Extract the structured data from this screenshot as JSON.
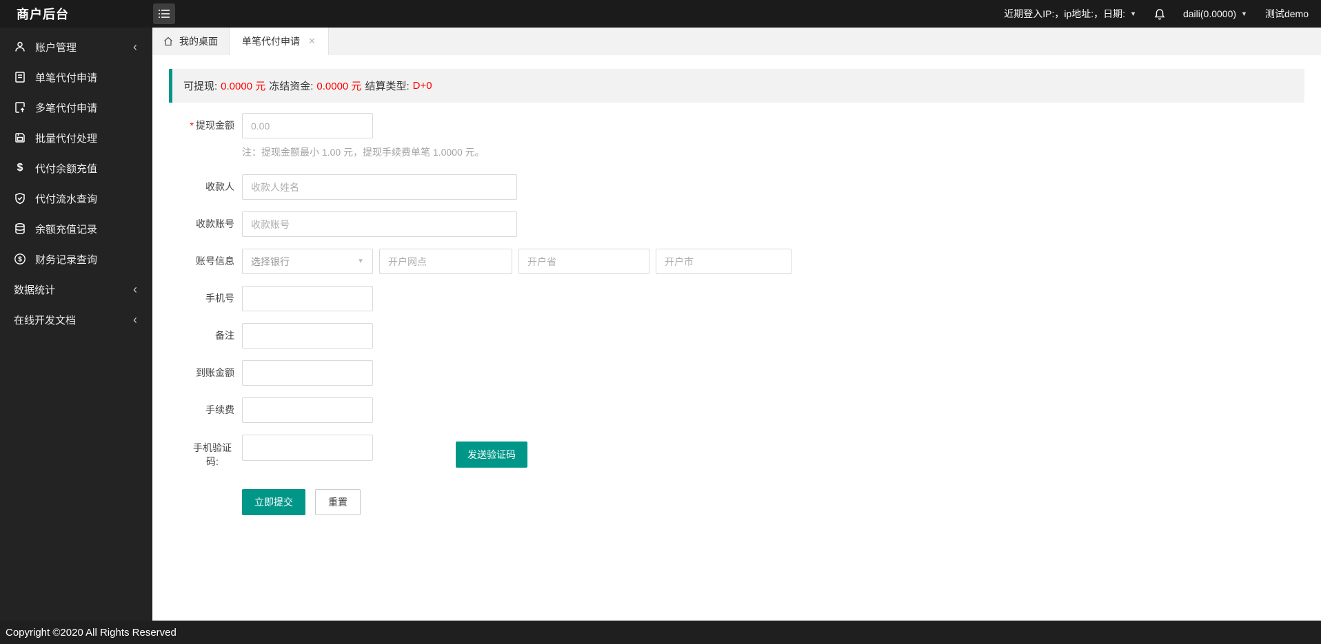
{
  "topbar": {
    "title": "商户后台",
    "login_info": "近期登入IP:，ip地址:，日期:",
    "user": "daili(0.0000)",
    "merchant": "测试demo"
  },
  "tabs": [
    {
      "label": "我的桌面"
    },
    {
      "label": "单笔代付申请"
    }
  ],
  "sidebar": {
    "items": [
      {
        "label": "账户管理"
      },
      {
        "label": "单笔代付申请"
      },
      {
        "label": "多笔代付申请"
      },
      {
        "label": "批量代付处理"
      },
      {
        "label": "代付余额充值"
      },
      {
        "label": "代付流水查询"
      },
      {
        "label": "余额充值记录"
      },
      {
        "label": "财务记录查询"
      },
      {
        "label": "数据统计"
      },
      {
        "label": "在线开发文档"
      }
    ]
  },
  "alert": {
    "segments": [
      {
        "text": "可提现:"
      },
      {
        "text": "0.0000 元"
      },
      {
        "text": "冻结资金:"
      },
      {
        "text": "0.0000 元"
      },
      {
        "text": "结算类型:"
      },
      {
        "text": "D+0"
      }
    ]
  },
  "form": {
    "amount": {
      "label": "提现金额",
      "placeholder": "0.00",
      "note": "注：提现金额最小 1.00 元，提现手续费单笔 1.0000 元。"
    },
    "payee": {
      "label": "收款人",
      "placeholder": "收款人姓名"
    },
    "account": {
      "label": "收款账号",
      "placeholder": "收款账号"
    },
    "account_info": {
      "label": "账号信息",
      "bank_placeholder": "选择银行",
      "branch_placeholder": "开户网点",
      "province_placeholder": "开户省",
      "city_placeholder": "开户市"
    },
    "phone": {
      "label": "手机号"
    },
    "remark": {
      "label": "备注"
    },
    "arrival": {
      "label": "到账金额"
    },
    "fee": {
      "label": "手续费"
    },
    "sms": {
      "label": "手机验证码:",
      "send_button": "发送验证码"
    },
    "submit_label": "立即提交",
    "reset_label": "重置"
  },
  "colors": {
    "accent": "#009688",
    "danger": "#ff0000",
    "dark": "#1b1b1b"
  },
  "footer": {
    "copyright": "Copyright ©2020 All Rights Reserved"
  }
}
